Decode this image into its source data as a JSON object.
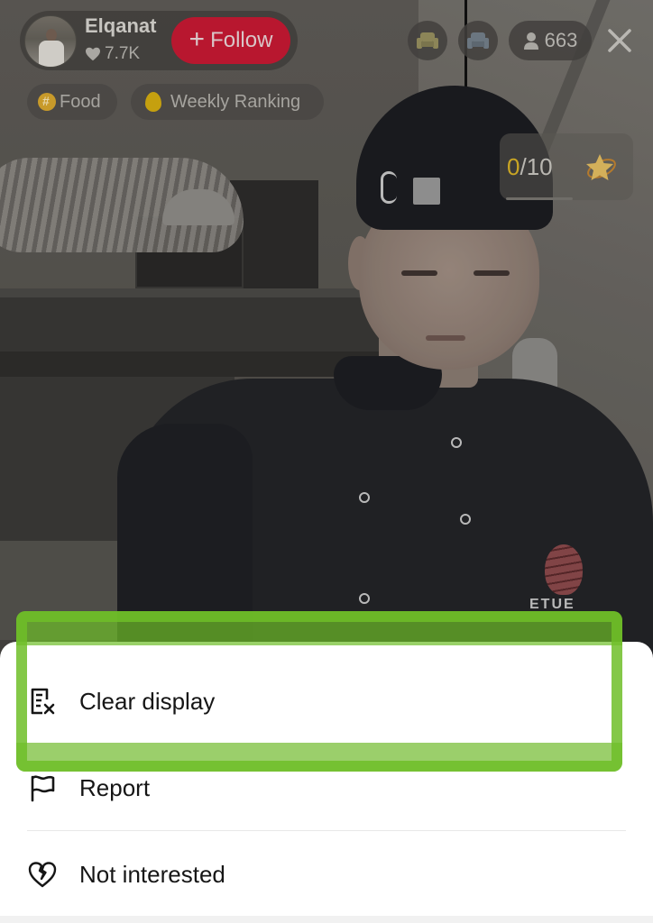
{
  "host": {
    "name": "Elqanat",
    "likes": "7.7K",
    "follow_label": "Follow",
    "follow_prefix": "+"
  },
  "tags": [
    {
      "label": "Food",
      "icon": "hashtag-icon"
    },
    {
      "label": "Weekly Ranking",
      "icon": "flame-icon"
    }
  ],
  "top_right": {
    "seat_icons": [
      "seat-gold-icon",
      "seat-silver-icon"
    ],
    "viewer_count": "663",
    "close_icon": "close-icon"
  },
  "goal": {
    "current": "0",
    "separator_total": "/10",
    "progress": 0,
    "icon": "star-icon"
  },
  "video": {
    "shirt_logo_text": "ETUE"
  },
  "menu": {
    "items": [
      {
        "label": "Clear display",
        "icon": "clear-display-icon",
        "highlighted": true
      },
      {
        "label": "Report",
        "icon": "flag-icon"
      },
      {
        "label": "Not interested",
        "icon": "broken-heart-icon"
      }
    ]
  },
  "colors": {
    "follow": "#b8172f",
    "highlight": "#6ebe28",
    "goal_accent": "#c9a524",
    "sheet_bg": "#ffffff",
    "text": "#161616"
  }
}
